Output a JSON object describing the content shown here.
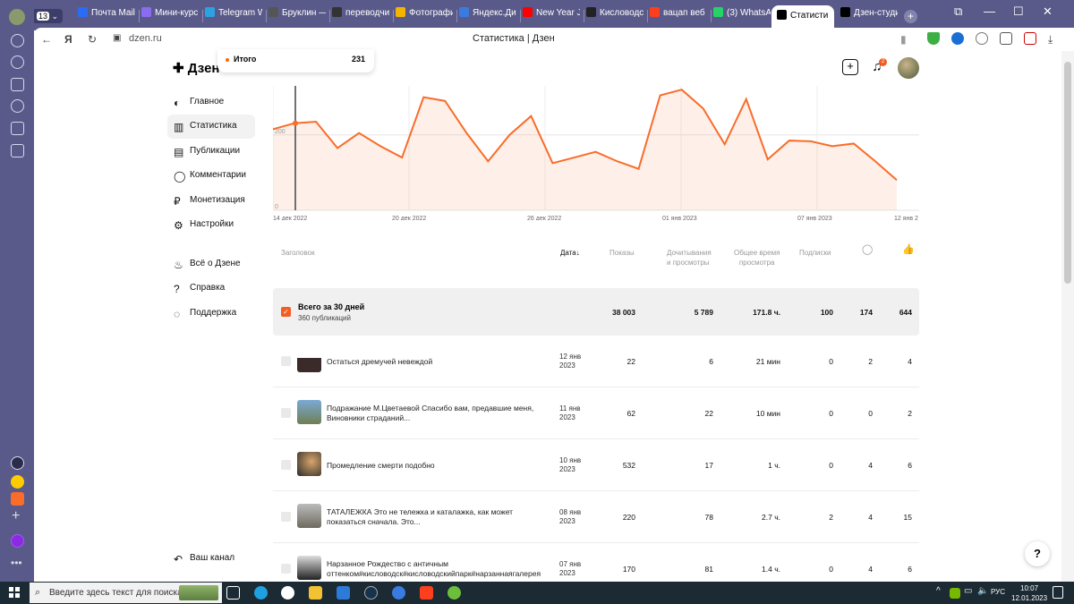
{
  "browser": {
    "tab_count": "13",
    "tabs": [
      {
        "label": "Почта Mail",
        "color": "#2b6cf6"
      },
      {
        "label": "Мини-курс",
        "color": "#8a6cf0"
      },
      {
        "label": "Telegram W",
        "color": "#2aa3e0"
      },
      {
        "label": "Бруклин —",
        "color": "#555555"
      },
      {
        "label": "переводчи",
        "color": "#333333"
      },
      {
        "label": "Фотографи",
        "color": "#f4b400"
      },
      {
        "label": "Яндекс.Дис",
        "color": "#3a7be0"
      },
      {
        "label": "New Year Ja",
        "color": "#ff0000"
      },
      {
        "label": "Кисловодс",
        "color": "#222222"
      },
      {
        "label": "вацап веб",
        "color": "#fc3f1d"
      },
      {
        "label": "(3) WhatsAp",
        "color": "#25d366"
      },
      {
        "label": "Статисти",
        "color": "#000000"
      },
      {
        "label": "Дзен-студи",
        "color": "#000000"
      }
    ],
    "url": "dzen.ru",
    "page_title": "Статистика | Дзен"
  },
  "app": {
    "logo": "Дзен-с",
    "nav": [
      {
        "label": "Главное",
        "icon": "planet-icon"
      },
      {
        "label": "Статистика",
        "icon": "bar-chart-icon"
      },
      {
        "label": "Публикации",
        "icon": "document-icon"
      },
      {
        "label": "Комментарии",
        "icon": "comment-icon"
      },
      {
        "label": "Монетизация",
        "icon": "ruble-icon"
      },
      {
        "label": "Настройки",
        "icon": "gear-icon"
      }
    ],
    "nav2": [
      {
        "label": "Всё о Дзене",
        "icon": "flame-icon"
      },
      {
        "label": "Справка",
        "icon": "help-icon"
      },
      {
        "label": "Поддержка",
        "icon": "chat-icon"
      }
    ],
    "your_channel": "Ваш канал",
    "notification_count": "2",
    "help_label": "?"
  },
  "tooltip": {
    "label": "Итого",
    "value": "231"
  },
  "chart_data": {
    "type": "area",
    "x_ticks": [
      "14 дек 2022",
      "20 дек 2022",
      "26 дек 2022",
      "01 янв 2023",
      "07 янв 2023",
      "12 янв 2"
    ],
    "y_ticks": [
      "0",
      "200"
    ],
    "values": [
      215,
      231,
      235,
      165,
      205,
      170,
      140,
      300,
      290,
      205,
      130,
      200,
      250,
      125,
      140,
      155,
      130,
      110,
      305,
      320,
      270,
      175,
      295,
      135,
      185,
      183,
      170,
      177,
      130,
      80
    ],
    "ylim": [
      0,
      330
    ],
    "color": "#f96c2a"
  },
  "table": {
    "columns": [
      "Заголовок",
      "Дата",
      "Показы",
      "Дочитывания и просмотры",
      "Общее время просмотра",
      "Подписки",
      "comment-icon",
      "like-icon"
    ],
    "col_title": "Заголовок",
    "col_date": "Дата",
    "col_sort": "↓",
    "col_views": "Показы",
    "col_reads_1": "Дочитывания",
    "col_reads_2": "и просмотры",
    "col_time_1": "Общее время",
    "col_time_2": "просмотра",
    "col_subs": "Подписки",
    "total": {
      "title": "Всего за 30 дней",
      "subtitle": "360 публикаций",
      "views": "38 003",
      "reads": "5 789",
      "time": "171.8 ч.",
      "subs": "100",
      "comments": "174",
      "likes": "644"
    },
    "rows": [
      {
        "title": "Остаться дремучей невеждой",
        "date1": "12 янв",
        "date2": "2023",
        "views": "22",
        "reads": "6",
        "time": "21 мин",
        "subs": "0",
        "comments": "2",
        "likes": "4"
      },
      {
        "title": "Подражание М.Цветаевой Спасибо вам, предавшие меня, Виновники страданий...",
        "date1": "11 янв",
        "date2": "2023",
        "views": "62",
        "reads": "22",
        "time": "10 мин",
        "subs": "0",
        "comments": "0",
        "likes": "2"
      },
      {
        "title": "Промедление смерти подобно",
        "date1": "10 янв",
        "date2": "2023",
        "views": "532",
        "reads": "17",
        "time": "1 ч.",
        "subs": "0",
        "comments": "4",
        "likes": "6"
      },
      {
        "title": "ТАТАЛЕЖКА Это не тележка и каталажка, как может показаться сначала. Это...",
        "date1": "08 янв",
        "date2": "2023",
        "views": "220",
        "reads": "78",
        "time": "2.7 ч.",
        "subs": "2",
        "comments": "4",
        "likes": "15"
      },
      {
        "title": "Нарзанное Рождество с античным оттенком#кисловодск#кисловодскийпарк#нарзаннаягалерея",
        "date1": "07 янв",
        "date2": "2023",
        "views": "170",
        "reads": "81",
        "time": "1.4 ч.",
        "subs": "0",
        "comments": "4",
        "likes": "6"
      }
    ]
  },
  "taskbar": {
    "search_placeholder": "Введите здесь текст для поиска",
    "lang": "РУС",
    "time": "10:07",
    "date": "12.01.2023"
  }
}
